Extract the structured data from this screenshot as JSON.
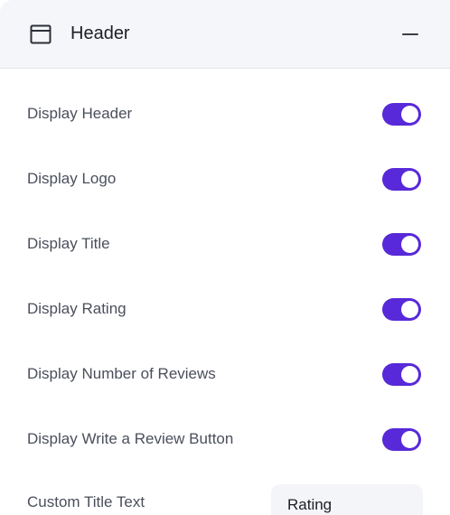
{
  "header": {
    "title": "Header",
    "icon": "layout-panel-icon",
    "collapse_icon": "minus-icon"
  },
  "settings": [
    {
      "label": "Display Header",
      "enabled": true
    },
    {
      "label": "Display Logo",
      "enabled": true
    },
    {
      "label": "Display Title",
      "enabled": true
    },
    {
      "label": "Display Rating",
      "enabled": true
    },
    {
      "label": "Display Number of Reviews",
      "enabled": true
    },
    {
      "label": "Display Write a Review Button",
      "enabled": true
    }
  ],
  "custom_title": {
    "label": "Custom Title Text",
    "value": "Rating"
  },
  "colors": {
    "accent": "#5729d9",
    "header_bg": "#f5f6f9"
  }
}
